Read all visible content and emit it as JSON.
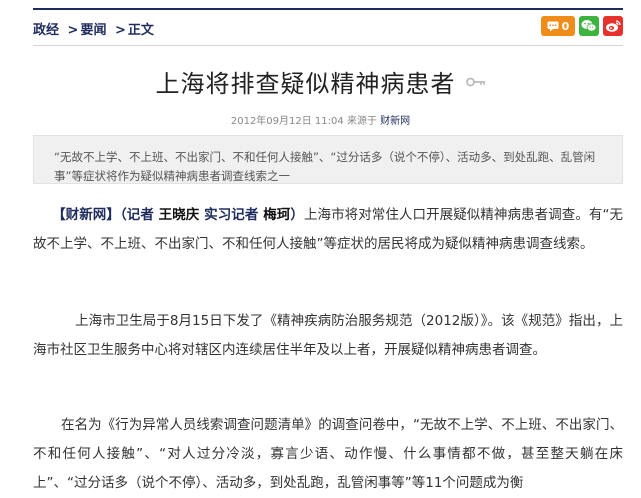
{
  "breadcrumb": {
    "items": [
      "政经",
      "要闻",
      "正文"
    ],
    "sep": ">"
  },
  "tools": {
    "comment_count": "0",
    "icons": [
      "comment-icon",
      "wechat-icon",
      "weibo-icon"
    ],
    "colors": {
      "comment": "#f08c1a",
      "wechat": "#3fb33f",
      "weibo": "#e5322d"
    }
  },
  "article": {
    "title": "上海将排查疑似精神病患者",
    "date": "2012年09月12日 11:04",
    "source_label": "来源于",
    "source": "财新网",
    "summary": "“无故不上学、不上班、不出家门、不和任何人接触”、“过分话多（说个不停）、活动多、到处乱跑、乱管闲事”等症状将作为疑似精神病患者调查线索之一",
    "p1": {
      "bracket_open": "【",
      "outlet": "财新网",
      "bracket_close": "】",
      "reporter_open": "（记者 ",
      "reporter": "王晓庆",
      "intern_label": " 实习记者 ",
      "intern": "梅珂",
      "reporter_close": "）",
      "text": "上海市将对常住人口开展疑似精神病患者调查。有“无故不上学、不上班、不出家门、不和任何人接触”等症状的居民将成为疑似精神病患调查线索。"
    },
    "p2": "上海市卫生局于8月15日下发了《精神疾病防治服务规范（2012版）》。该《规范》指出，上海市社区卫生服务中心将对辖区内连续居住半年及以上者，开展疑似精神病患者调查。",
    "p3": "在名为《行为异常人员线索调查问题清单》的调查问卷中，“无故不上学、不上班、不出家门、不和任何人接触”、“对人过分冷淡，寡言少语、动作慢、什么事情都不做，甚至整天躺在床上”、“过分话多（说个不停）、活动多，到处乱跑，乱管闲事等”等11个问题成为衡"
  },
  "colors": {
    "accent": "#1f2c5c"
  }
}
